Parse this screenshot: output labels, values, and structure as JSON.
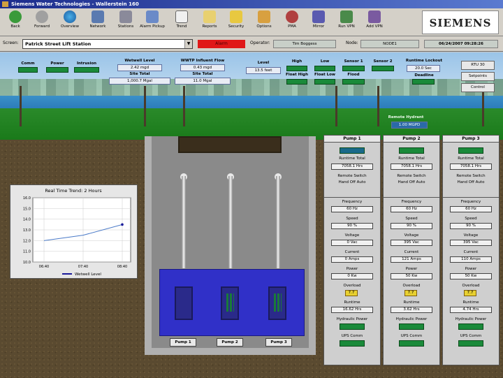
{
  "window": {
    "title": "Siemens Water Technologies - Wallerstein 160"
  },
  "toolbar": {
    "buttons": [
      {
        "label": "Back",
        "icon": "back-arrow-icon"
      },
      {
        "label": "Forward",
        "icon": "forward-arrow-icon"
      },
      {
        "label": "Overview",
        "icon": "globe-icon"
      },
      {
        "label": "Network",
        "icon": "network-icon"
      },
      {
        "label": "Stations",
        "icon": "station-icon"
      },
      {
        "label": "Alarm Pickup",
        "icon": "alarm-pickup-icon"
      },
      {
        "label": "Trend",
        "icon": "trend-icon"
      },
      {
        "label": "Reports",
        "icon": "reports-icon"
      },
      {
        "label": "Security",
        "icon": "security-icon"
      },
      {
        "label": "Options",
        "icon": "options-icon"
      },
      {
        "label": "PMA",
        "icon": "pma-icon"
      },
      {
        "label": "Mirror",
        "icon": "mirror-icon"
      },
      {
        "label": "Run VPN",
        "icon": "vpn-icon"
      },
      {
        "label": "Add VPN",
        "icon": "add-vpn-icon"
      }
    ],
    "logo": "SIEMENS"
  },
  "screenbar": {
    "screen_label": "Screen:",
    "screen_value": "Patrick Street Lift Station",
    "alarm_label": "Alarm",
    "operator_label": "Operator:",
    "operator_value": "Tim Boggess",
    "node_label": "Node:",
    "node_value": "NODE1",
    "datetime": "06/24/2007  09:28:26"
  },
  "scene": {
    "status_labels": [
      "Comm",
      "Power",
      "Intrusion"
    ],
    "wetwell_title": "Wetwell Level",
    "wetwell_value": "2.42 mgd",
    "wetwell_total_label": "Site Total",
    "wetwell_total": "1,000.7 Mgal",
    "flow_title": "WWTP Influent Flow",
    "flow_value": "0.43 mgd",
    "flow_total_label": "Site Total",
    "flow_total": "11.0 Mgal",
    "level_label": "Level",
    "level_value": "13.5 feet",
    "alarm_cols": [
      {
        "label": "High",
        "sub": "Float High"
      },
      {
        "label": "Low",
        "sub": "Float Low"
      },
      {
        "label": "Sensor 1",
        "sub": "Flood"
      },
      {
        "label": "Sensor 2",
        "sub": ""
      }
    ],
    "runtime_title": "Runtime Lockout",
    "runtime_value": "20.0 Sec",
    "runtime_sub": "Deadline",
    "side_buttons": [
      "RTU 30",
      "Setpoints",
      "Control"
    ],
    "hydrant_label": "Remote Hydrant",
    "hydrant_value": "1.00 MGPD"
  },
  "pumps": [
    {
      "name": "Pump 1",
      "runtime_label": "Runtime Total",
      "runtime": "7058.1 Hrs",
      "remote_label": "Remote Switch",
      "remote_opts": "Hand  Off  Auto",
      "rows": [
        {
          "label": "Frequency",
          "value": "60 Hz"
        },
        {
          "label": "Speed",
          "value": "90 %"
        },
        {
          "label": "Voltage",
          "value": "0 Vac"
        },
        {
          "label": "Current",
          "value": "0 Amps"
        },
        {
          "label": "Power",
          "value": "0 Kw"
        }
      ],
      "overload_label": "Overload",
      "overload_value": "7.7",
      "runtime2_label": "Runtime",
      "runtime2": "16.62 Hrs",
      "hydraulic_label": "Hydraulic Power",
      "ups_label": "UPS Comm"
    },
    {
      "name": "Pump 2",
      "runtime_label": "Runtime Total",
      "runtime": "7058.1 Hrs",
      "remote_label": "Remote Switch",
      "remote_opts": "Hand  Off  Auto",
      "rows": [
        {
          "label": "Frequency",
          "value": "60 Hz"
        },
        {
          "label": "Speed",
          "value": "90 %"
        },
        {
          "label": "Voltage",
          "value": "395 Vac"
        },
        {
          "label": "Current",
          "value": "121 Amps"
        },
        {
          "label": "Power",
          "value": "50 Kw"
        }
      ],
      "overload_label": "Overload",
      "overload_value": "7.7",
      "runtime2_label": "Runtime",
      "runtime2": "3.62 Hrs",
      "hydraulic_label": "Hydraulic Power",
      "ups_label": "UPS Comm"
    },
    {
      "name": "Pump 3",
      "runtime_label": "Runtime Total",
      "runtime": "7058.1 Hrs",
      "remote_label": "Remote Switch",
      "remote_opts": "Hand  Off  Auto",
      "rows": [
        {
          "label": "Frequency",
          "value": "60 Hz"
        },
        {
          "label": "Speed",
          "value": "90 %"
        },
        {
          "label": "Voltage",
          "value": "395 Vac"
        },
        {
          "label": "Current",
          "value": "110 Amps"
        },
        {
          "label": "Power",
          "value": "50 Kw"
        }
      ],
      "overload_label": "Overload",
      "overload_value": "7.7",
      "runtime2_label": "Runtime",
      "runtime2": "4.74 Hrs",
      "hydraulic_label": "Hydraulic Power",
      "ups_label": "UPS Comm"
    }
  ],
  "pump_labels": [
    "Pump 1",
    "Pump 2",
    "Pump 3"
  ],
  "trend": {
    "title": "Real Time Trend: 2 Hours",
    "legend": "Wetwell Level"
  },
  "chart_data": {
    "type": "line",
    "title": "Real Time Trend: 2 Hours",
    "x": [
      "06:40",
      "07:40",
      "08:40"
    ],
    "series": [
      {
        "name": "Wetwell Level",
        "values": [
          12.0,
          12.5,
          13.5
        ]
      }
    ],
    "yticks": [
      10.0,
      11.0,
      12.0,
      13.0,
      14.0,
      15.0,
      16.0
    ],
    "ylim": [
      10,
      16
    ],
    "grid": true,
    "legend": "bottom"
  },
  "colors": {
    "indicator_on": "#1a8a3a",
    "alarm": "#e01818",
    "water": "#3030c8"
  }
}
